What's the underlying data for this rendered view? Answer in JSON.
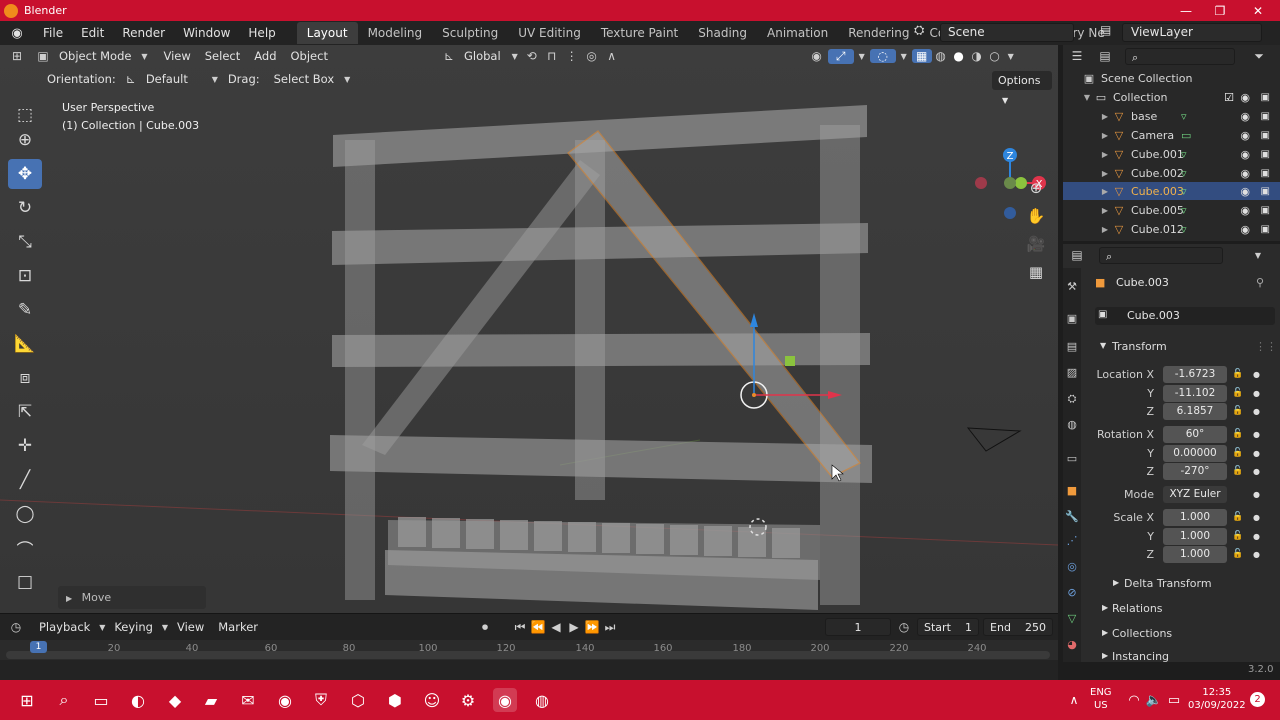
{
  "titlebar": {
    "title": "Blender",
    "minimize": "—",
    "maximize": "❐",
    "close": "✕"
  },
  "menubar": {
    "items": [
      "File",
      "Edit",
      "Render",
      "Window",
      "Help"
    ],
    "workspaces": [
      "Layout",
      "Modeling",
      "Sculpting",
      "UV Editing",
      "Texture Paint",
      "Shading",
      "Animation",
      "Rendering",
      "Compositing",
      "Geometry Ne"
    ],
    "scene": "Scene",
    "view_layer": "ViewLayer"
  },
  "viewport": {
    "mode": "Object Mode",
    "menus": [
      "View",
      "Select",
      "Add",
      "Object"
    ],
    "transform_orientation": "Global",
    "orientation_label": "Orientation:",
    "orientation_value": "Default",
    "drag_label": "Drag:",
    "drag_value": "Select Box",
    "options": "Options",
    "info_line1": "User Perspective",
    "info_line2": "(1) Collection | Cube.003",
    "last_op": "Move",
    "gizmo_colors": {
      "x": "#e0344b",
      "y": "#8bc33e",
      "z": "#2e86de"
    }
  },
  "timeline": {
    "menus": [
      "Playback",
      "Keying",
      "View",
      "Marker"
    ],
    "current_frame": "1",
    "start_label": "Start",
    "start": "1",
    "end_label": "End",
    "end": "250",
    "ticks": [
      "1",
      "20",
      "40",
      "60",
      "80",
      "100",
      "120",
      "140",
      "160",
      "180",
      "200",
      "220",
      "240"
    ]
  },
  "outliner": {
    "root": "Scene Collection",
    "collection": "Collection",
    "items": [
      {
        "name": "base",
        "selected": false
      },
      {
        "name": "Camera",
        "selected": false
      },
      {
        "name": "Cube.001",
        "selected": false
      },
      {
        "name": "Cube.002",
        "selected": false
      },
      {
        "name": "Cube.003",
        "selected": true
      },
      {
        "name": "Cube.005",
        "selected": false
      },
      {
        "name": "Cube.012",
        "selected": false
      }
    ]
  },
  "properties": {
    "object_name": "Cube.003",
    "data_name": "Cube.003",
    "section_transform": "Transform",
    "location_label": "Location X",
    "location": {
      "x": "-1.6723",
      "y": "-11.102",
      "z": "6.1857"
    },
    "rotation_label": "Rotation X",
    "rotation": {
      "x": "60°",
      "y": "0.00000",
      "z": "-270°"
    },
    "mode_label": "Mode",
    "mode": "XYZ Euler",
    "scale_label": "Scale X",
    "scale": {
      "x": "1.000",
      "y": "1.000",
      "z": "1.000"
    },
    "axis_y": "Y",
    "axis_z": "Z",
    "delta_transform": "Delta Transform",
    "relations": "Relations",
    "collections": "Collections",
    "instancing": "Instancing"
  },
  "status": {
    "version": "3.2.0"
  },
  "taskbar": {
    "lang": "ENG",
    "region": "US",
    "time": "12:35",
    "date": "03/09/2022",
    "notifications": "2"
  }
}
